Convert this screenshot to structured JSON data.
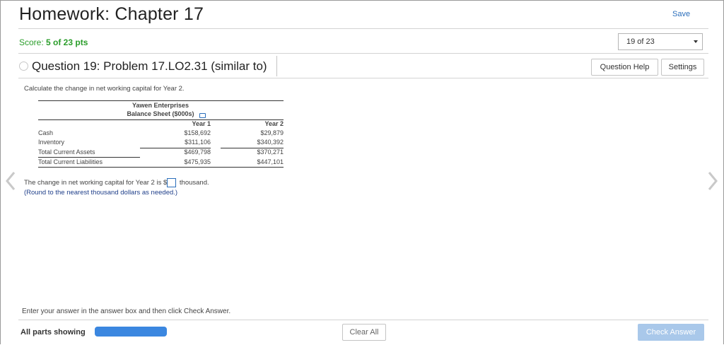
{
  "page": {
    "title": "Homework: Chapter 17",
    "save_label": "Save",
    "score_prefix": "Score: ",
    "score_value": "5 of 23 pts",
    "question_select": "19 of 23",
    "question_title": "Question 19: Problem 17.LO2.31 (similar to)",
    "question_help_label": "Question Help",
    "settings_label": "Settings"
  },
  "problem": {
    "instruction": "Calculate the change in net working capital for Year 2.",
    "table": {
      "company": "Yawen Enterprises",
      "sheet_title": "Balance Sheet ($000s)",
      "columns": [
        "Year 1",
        "Year 2"
      ],
      "rows": [
        {
          "label": "Cash",
          "year1": "$158,692",
          "year2": "$29,879"
        },
        {
          "label": "Inventory",
          "year1": "$311,106",
          "year2": "$340,392"
        },
        {
          "label": "Total Current Assets",
          "year1": "$469,798",
          "year2": "$370,271"
        },
        {
          "label": "Total Current Liabilities",
          "year1": "$475,935",
          "year2": "$447,101"
        }
      ]
    },
    "answer_prefix": "The change in net working capital for Year 2 is $",
    "answer_value": "",
    "answer_suffix": " thousand.",
    "round_note": "(Round to the nearest thousand dollars as needed.)"
  },
  "footer": {
    "enter_note": "Enter your answer in the answer box and then click Check Answer.",
    "all_parts": "All parts showing",
    "progress_fraction": 1.0,
    "clear_all_label": "Clear All",
    "check_answer_label": "Check Answer"
  },
  "icons": {
    "prev": "chevron-left-icon",
    "next": "chevron-right-icon",
    "copy": "copy-table-icon"
  },
  "colors": {
    "link": "#2a6ebb",
    "score": "#2a9d2a",
    "progress": "#3b87e0",
    "check_button": "#a9c8ea"
  }
}
